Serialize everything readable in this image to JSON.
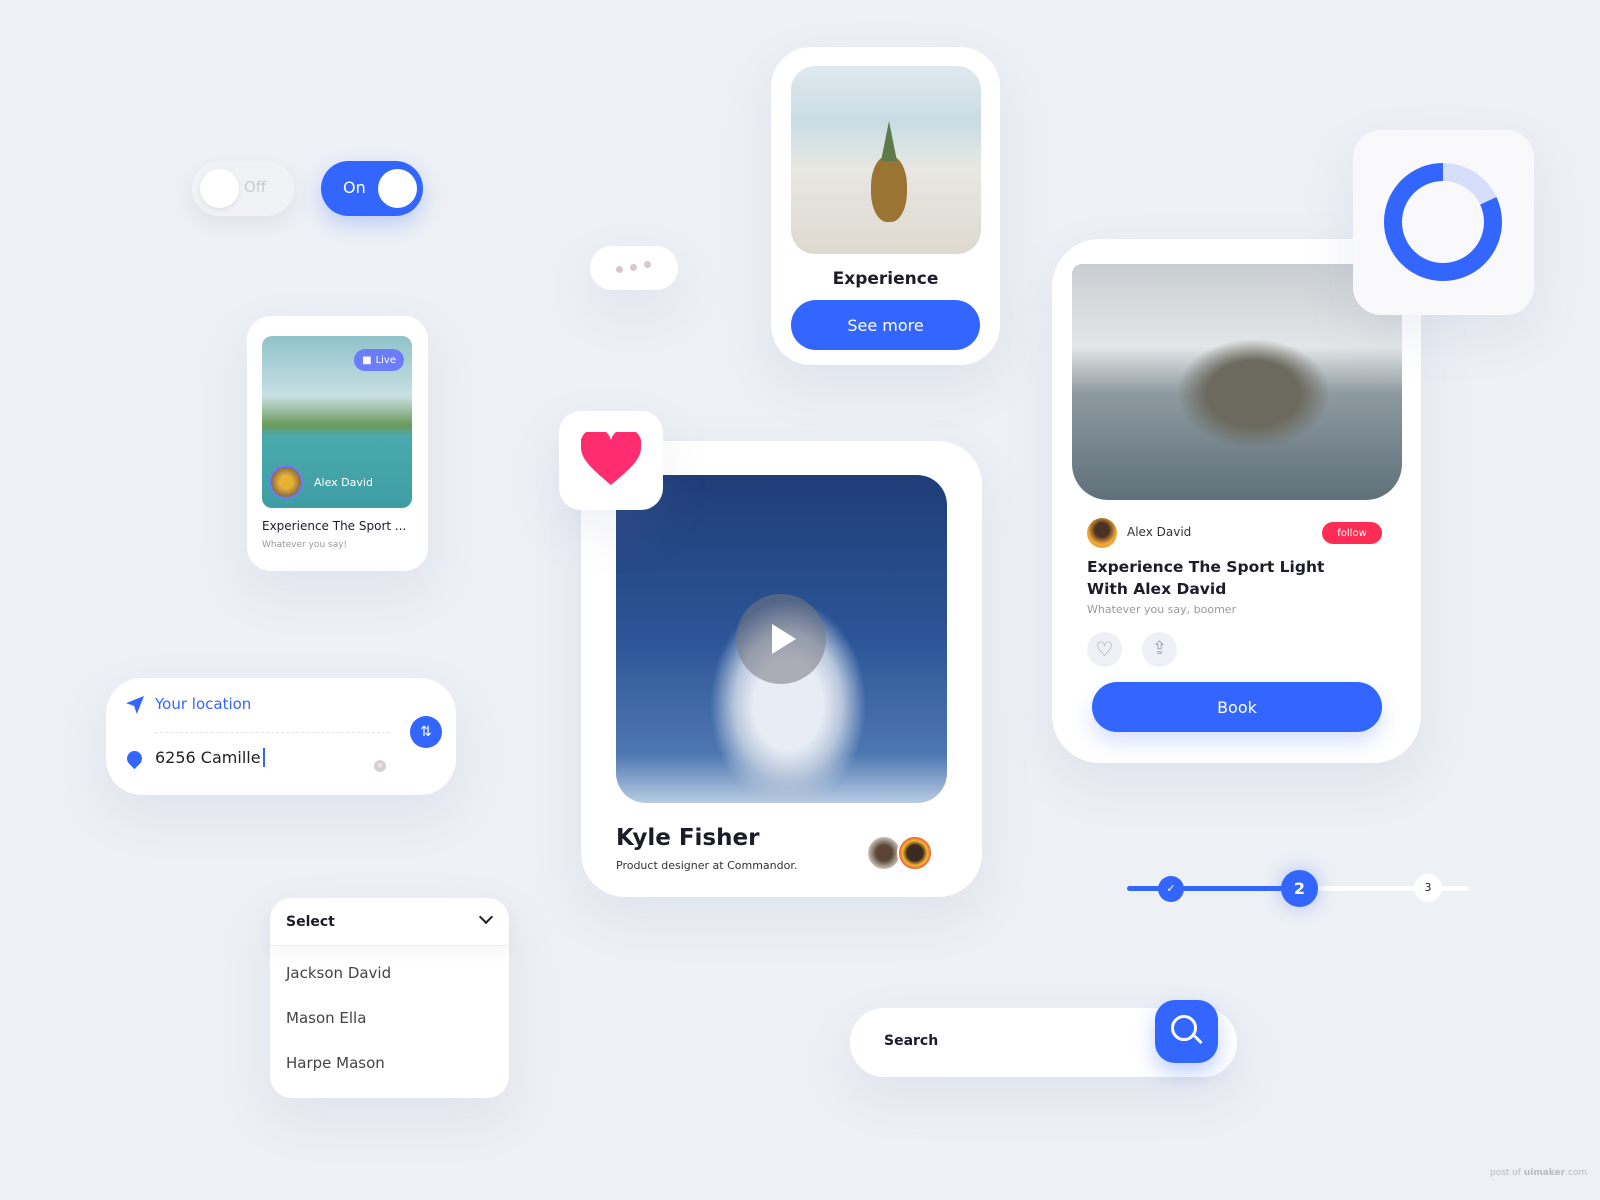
{
  "toggles": {
    "off_label": "Off",
    "on_label": "On"
  },
  "small_card": {
    "live_label": "Live",
    "author": "Alex David",
    "title": "Experience The Sport ...",
    "subtitle": "Whatever you say!"
  },
  "experience_card": {
    "title": "Experience",
    "button": "See more"
  },
  "donut": {
    "progress_percent": 82,
    "color": "#3366ff",
    "track_color": "#d6defc"
  },
  "feature_card": {
    "author": "Alex David",
    "follow_label": "follow",
    "title": "Experience The Sport Light With Alex David",
    "subtitle": "Whatever you say, boomer",
    "book_label": "Book",
    "follow_color": "#ff2d55"
  },
  "video_card": {
    "name": "Kyle Fisher",
    "role": "Product designer at Commandor."
  },
  "location": {
    "origin_label": "Your location",
    "destination_value": "6256 Camille"
  },
  "select": {
    "label": "Select",
    "options": [
      "Jackson David",
      "Mason Ella",
      "Harpe Mason"
    ]
  },
  "search": {
    "placeholder": "Search"
  },
  "stepper": {
    "steps": [
      "✓",
      "2",
      "3"
    ],
    "current": 2
  },
  "watermark": {
    "prefix": "post of ",
    "brand": "uimaker",
    ".suffix": ".com",
    "suffix": ".com"
  },
  "colors": {
    "accent": "#3366ff",
    "heart": "#ff2d6f"
  }
}
